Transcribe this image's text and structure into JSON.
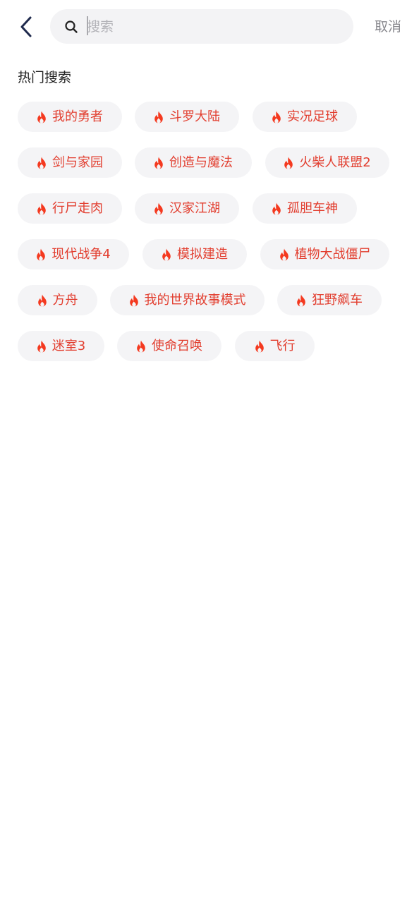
{
  "header": {
    "back_icon": "chevron-left-icon",
    "search": {
      "icon": "search-icon",
      "placeholder": "搜索",
      "value": ""
    },
    "cancel_label": "取消"
  },
  "hot_search": {
    "title": "热门搜索",
    "icon": "fire-icon",
    "accent_color": "#e23e2f",
    "tags": [
      "我的勇者",
      "斗罗大陆",
      "实况足球",
      "剑与家园",
      "创造与魔法",
      "火柴人联盟2",
      "行尸走肉",
      "汉家江湖",
      "孤胆车神",
      "现代战争4",
      "模拟建造",
      "植物大战僵尸",
      "方舟",
      "我的世界故事模式",
      "狂野飙车",
      "迷室3",
      "使命召唤",
      "飞行"
    ]
  }
}
